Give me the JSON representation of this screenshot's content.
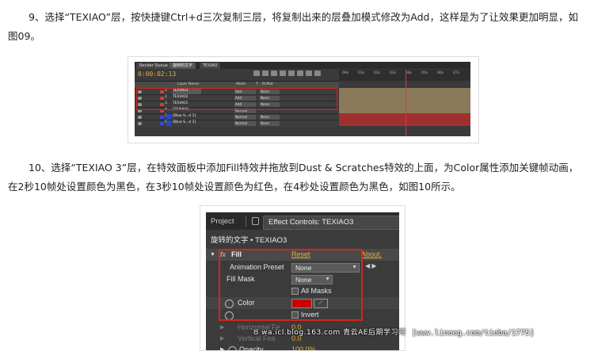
{
  "paragraph1": {
    "line1": "9、选择“TEXIAO”层，按快捷键Ctrl+d三次复制三层，将复制出来的层叠加模式修改为Add，这样是为了让效果更加明显，如",
    "line2": "图09。"
  },
  "paragraph2": {
    "line1": "10、选择“TEXIAO 3”层，在特效面板中添加Fill特效并拖放到Dust & Scratches特效的上面，为Color属性添加关键帧动画，",
    "line2": "在2秒10帧处设置颜色为黑色，在3秒10帧处设置颜色为红色，在4秒处设置颜色为黑色，如图10所示。"
  },
  "timeline": {
    "tabs": [
      "Render Queue",
      "旋转的文字",
      "TEXIAO"
    ],
    "timecode": "0:00:02:13",
    "ruler": [
      "00s",
      "01s",
      "02s",
      "03s",
      "04s",
      "05s",
      "06s",
      "07s"
    ],
    "headers": {
      "layer_name": "Layer Name",
      "mode": "Mode",
      "trkmat": "TrkMat",
      "t": "T"
    },
    "layers": [
      {
        "num": "1",
        "name": "TEXIAO3",
        "mode": "Add",
        "trkmat": "None",
        "color": "#c84040",
        "bar": "#8a7a5a"
      },
      {
        "num": "2",
        "name": "TEXIAO2",
        "mode": "Add",
        "trkmat": "None",
        "color": "#c84040",
        "bar": "#8a7a5a"
      },
      {
        "num": "3",
        "name": "TEXIAO1",
        "mode": "Add",
        "trkmat": "None",
        "color": "#c84040",
        "bar": "#8a7a5a"
      },
      {
        "num": "4",
        "name": "[TEXIAO]",
        "mode": "Normal",
        "trkmat": "",
        "color": "#c84040",
        "bar": "#8a7a5a"
      },
      {
        "num": "5",
        "name": "[Blue S...d 1]",
        "mode": "Normal",
        "trkmat": "None",
        "color": "#3050d0",
        "bar": "#a03030"
      },
      {
        "num": "6",
        "name": "[Blue S...d 1]",
        "mode": "Normal",
        "trkmat": "None",
        "color": "#3050d0",
        "bar": "#a03030"
      }
    ]
  },
  "effect_controls": {
    "tab_project": "Project",
    "tab_effect": "Effect Controls: TEXIAO3",
    "breadcrumb": "旋转的文字 • TEXIAO3",
    "fx": "fx",
    "effect_name": "Fill",
    "reset": "Reset",
    "about": "About.",
    "animation_preset_label": "Animation Preset",
    "animation_preset_value": "None",
    "fill_mask_label": "Fill Mask",
    "fill_mask_value": "None",
    "all_masks_label": "All Masks",
    "color_label": "Color",
    "invert_label": "Invert",
    "horizontal_label": "Horizontal Fe",
    "horizontal_value": "0.0",
    "vertical_label": "Vertical Fea",
    "vertical_value": "0.0",
    "opacity_label": "Opacity",
    "opacity_value": "100.0%",
    "color_value_hex": "#c80000"
  },
  "watermark": {
    "left": "Ȣ wa.icl.blog.163.com  青云AE后期学习吧",
    "right": "[www.lineeg.com/tieba/1775]"
  }
}
